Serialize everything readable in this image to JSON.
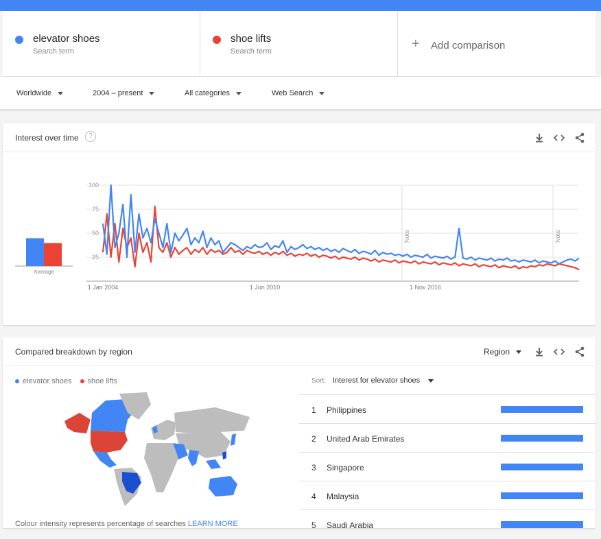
{
  "colors": {
    "blue": "#4285f4",
    "red": "#ea4335"
  },
  "terms": [
    {
      "name": "elevator shoes",
      "sub": "Search term",
      "color": "#4285f4"
    },
    {
      "name": "shoe lifts",
      "sub": "Search term",
      "color": "#ea4335"
    }
  ],
  "add_comparison": {
    "icon": "plus-icon",
    "label": "Add comparison"
  },
  "filters": {
    "region": "Worldwide",
    "time": "2004 – present",
    "category": "All categories",
    "search_type": "Web Search"
  },
  "interest_card": {
    "title": "Interest over time",
    "help_icon": "?",
    "average_label": "Average",
    "note_label": "Note"
  },
  "chart_data": {
    "type": "line",
    "ylim": [
      0,
      100
    ],
    "yticks": [
      25,
      50,
      75,
      100
    ],
    "xtick_labels": [
      "1 Jan 2004",
      "1 Jun 2010",
      "1 Nov 2016"
    ],
    "averages": {
      "elevator shoes": 29,
      "shoe lifts": 24
    },
    "series": [
      {
        "name": "elevator shoes",
        "color": "#4285f4",
        "values": [
          60,
          28,
          100,
          35,
          50,
          80,
          25,
          90,
          30,
          70,
          45,
          55,
          40,
          65,
          50,
          35,
          60,
          30,
          50,
          42,
          48,
          55,
          38,
          45,
          40,
          52,
          35,
          45,
          38,
          42,
          30,
          35,
          40,
          38,
          35,
          32,
          36,
          34,
          38,
          35,
          36,
          40,
          33,
          37,
          35,
          42,
          30,
          36,
          33,
          35,
          38,
          34,
          36,
          33,
          35,
          32,
          34,
          31,
          33,
          30,
          34,
          32,
          30,
          33,
          29,
          31,
          30,
          28,
          32,
          27,
          30,
          28,
          29,
          27,
          28,
          26,
          28,
          25,
          27,
          26,
          25,
          28,
          24,
          26,
          25,
          24,
          26,
          23,
          25,
          55,
          24,
          23,
          25,
          22,
          24,
          23,
          22,
          24,
          21,
          23,
          22,
          24,
          21,
          22,
          20,
          22,
          21,
          20,
          22,
          19,
          21,
          20,
          19,
          21,
          18,
          20,
          22,
          23,
          21,
          24
        ]
      },
      {
        "name": "shoe lifts",
        "color": "#ea4335",
        "values": [
          30,
          70,
          25,
          60,
          20,
          55,
          35,
          45,
          15,
          50,
          30,
          40,
          20,
          78,
          35,
          30,
          40,
          25,
          35,
          28,
          32,
          35,
          28,
          33,
          30,
          35,
          28,
          33,
          30,
          32,
          28,
          30,
          35,
          30,
          32,
          28,
          32,
          30,
          29,
          31,
          28,
          30,
          27,
          30,
          28,
          31,
          27,
          29,
          26,
          28,
          27,
          29,
          26,
          28,
          25,
          27,
          26,
          24,
          26,
          23,
          25,
          24,
          23,
          25,
          22,
          24,
          23,
          21,
          23,
          20,
          22,
          21,
          20,
          22,
          19,
          21,
          20,
          19,
          21,
          18,
          20,
          19,
          18,
          20,
          17,
          19,
          18,
          17,
          19,
          16,
          18,
          17,
          16,
          18,
          15,
          17,
          16,
          15,
          17,
          14,
          16,
          15,
          14,
          16,
          13,
          15,
          14,
          16,
          15,
          17,
          16,
          18,
          17,
          16,
          18,
          17,
          16,
          15,
          14,
          12
        ]
      }
    ]
  },
  "region_card": {
    "title": "Compared breakdown by region",
    "region_select": "Region",
    "legend": [
      "elevator shoes",
      "shoe lifts"
    ],
    "sort_label": "Sort:",
    "sort_value": "Interest for elevator shoes",
    "rows": [
      {
        "rank": "1",
        "name": "Philippines",
        "share": 1
      },
      {
        "rank": "2",
        "name": "United Arab Emirates",
        "share": 1
      },
      {
        "rank": "3",
        "name": "Singapore",
        "share": 1
      },
      {
        "rank": "4",
        "name": "Malaysia",
        "share": 1
      },
      {
        "rank": "5",
        "name": "Saudi Arabia",
        "share": 1
      }
    ],
    "footer_text": "Colour intensity represents percentage of searches",
    "footer_link": "LEARN MORE"
  },
  "icons": {
    "download": "download-icon",
    "embed": "embed-icon",
    "share": "share-icon"
  }
}
